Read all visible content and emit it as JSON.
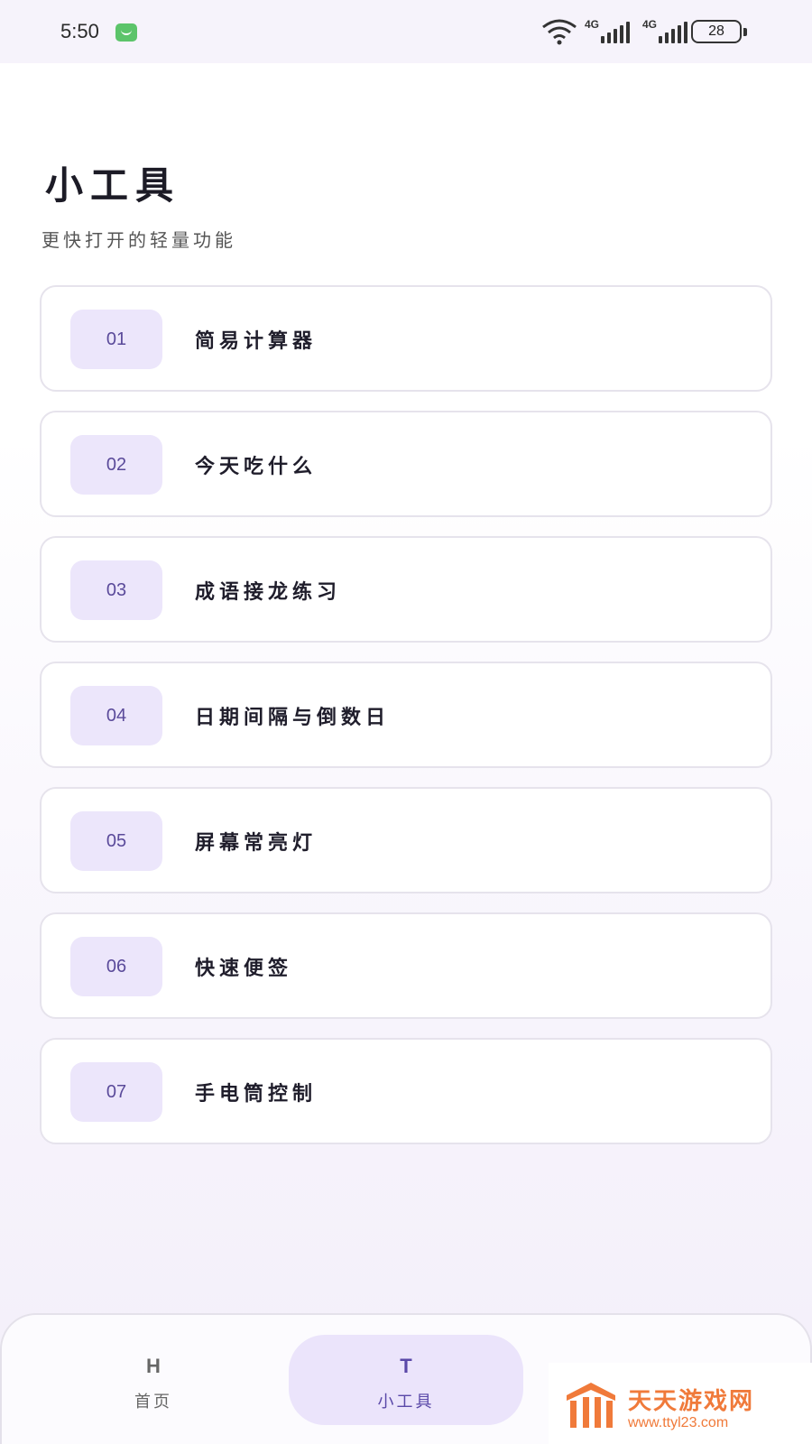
{
  "status_bar": {
    "time": "5:50",
    "signal1_label": "4G",
    "signal2_label": "4G",
    "battery": "28"
  },
  "page": {
    "title": "小工具",
    "subtitle": "更快打开的轻量功能"
  },
  "tools": [
    {
      "num": "01",
      "name": "简易计算器"
    },
    {
      "num": "02",
      "name": "今天吃什么"
    },
    {
      "num": "03",
      "name": "成语接龙练习"
    },
    {
      "num": "04",
      "name": "日期间隔与倒数日"
    },
    {
      "num": "05",
      "name": "屏幕常亮灯"
    },
    {
      "num": "06",
      "name": "快速便签"
    },
    {
      "num": "07",
      "name": "手电筒控制"
    }
  ],
  "bottom_nav": {
    "items": [
      {
        "letter": "H",
        "label": "首页"
      },
      {
        "letter": "T",
        "label": "小工具",
        "active": true
      }
    ]
  },
  "watermark": {
    "title": "天天游戏网",
    "url": "www.ttyl23.com"
  },
  "colors": {
    "accent": "#5a48a8",
    "chip_bg": "#ece6fb",
    "watermark": "#f07a3a"
  }
}
